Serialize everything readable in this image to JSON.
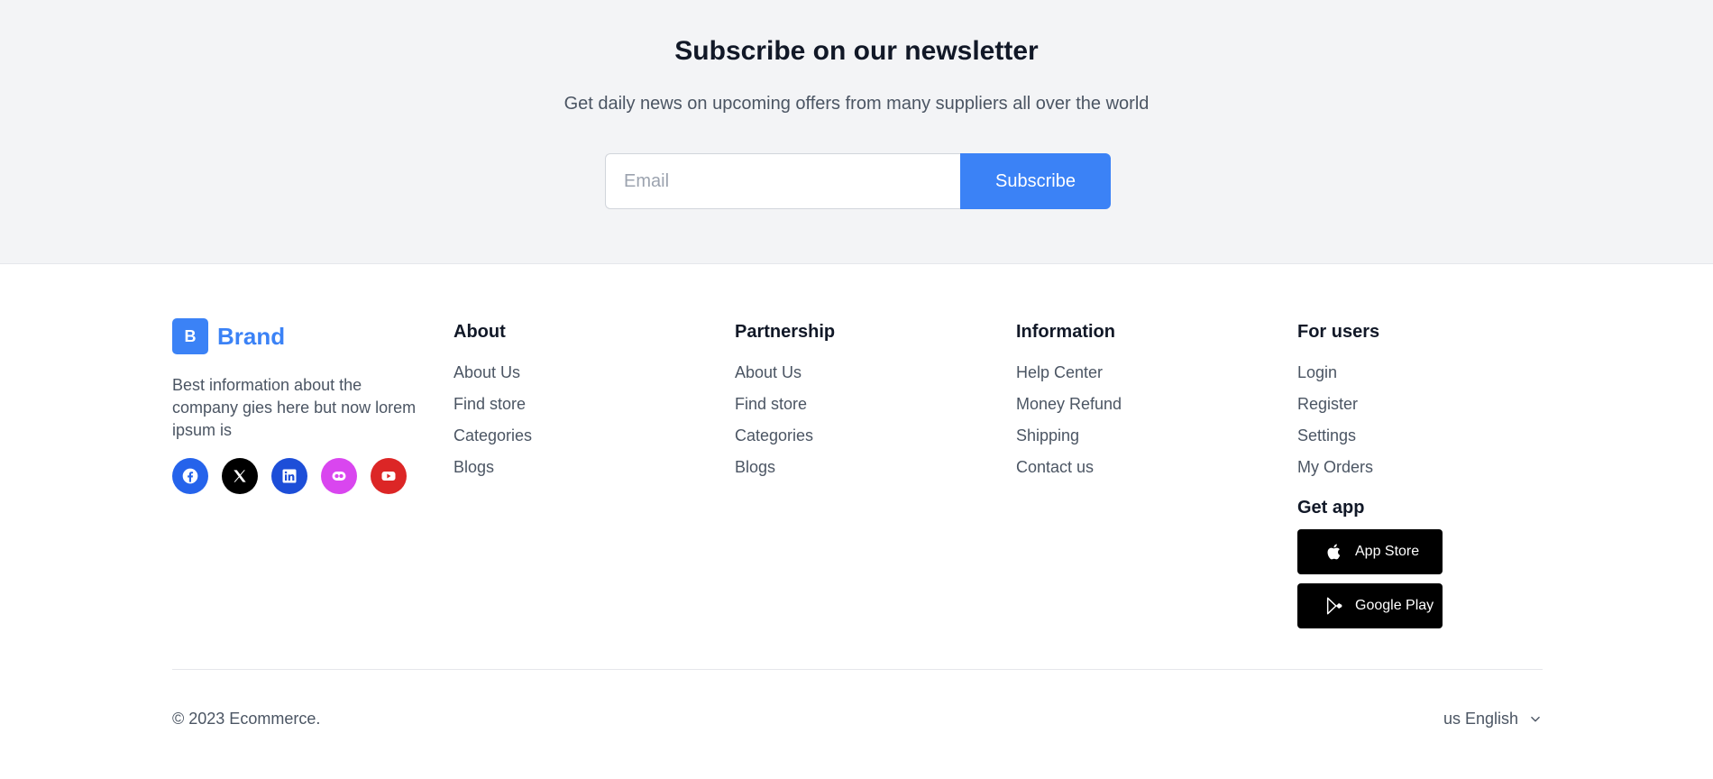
{
  "newsletter": {
    "title": "Subscribe on our newsletter",
    "subtitle": "Get daily news on upcoming offers from many suppliers all over the world",
    "email_placeholder": "Email",
    "subscribe_label": "Subscribe"
  },
  "brand": {
    "logo_letter": "B",
    "name": "Brand",
    "description": "Best information about the company gies here but now lorem ipsum is",
    "socials": [
      {
        "icon": "facebook-icon",
        "color": "#2563eb"
      },
      {
        "icon": "x-icon",
        "color": "#000000"
      },
      {
        "icon": "linkedin-icon",
        "color": "#1d4ed8"
      },
      {
        "icon": "flickr-icon",
        "color": "#d946ef"
      },
      {
        "icon": "youtube-icon",
        "color": "#dc2626"
      }
    ]
  },
  "columns": [
    {
      "title": "About",
      "links": [
        "About Us",
        "Find store",
        "Categories",
        "Blogs"
      ]
    },
    {
      "title": "Partnership",
      "links": [
        "About Us",
        "Find store",
        "Categories",
        "Blogs"
      ]
    },
    {
      "title": "Information",
      "links": [
        "Help Center",
        "Money Refund",
        "Shipping",
        "Contact us"
      ]
    },
    {
      "title": "For users",
      "links": [
        "Login",
        "Register",
        "Settings",
        "My Orders"
      ]
    }
  ],
  "get_app": {
    "title": "Get app",
    "app_store_label": "App Store",
    "google_play_label": "Google Play"
  },
  "bottom": {
    "copyright": "© 2023 Ecommerce.",
    "language": "us English"
  },
  "colors": {
    "accent": "#3b82f6",
    "newsletter_bg": "#f3f4f6",
    "text_muted": "#4b5563",
    "heading": "#111827"
  }
}
